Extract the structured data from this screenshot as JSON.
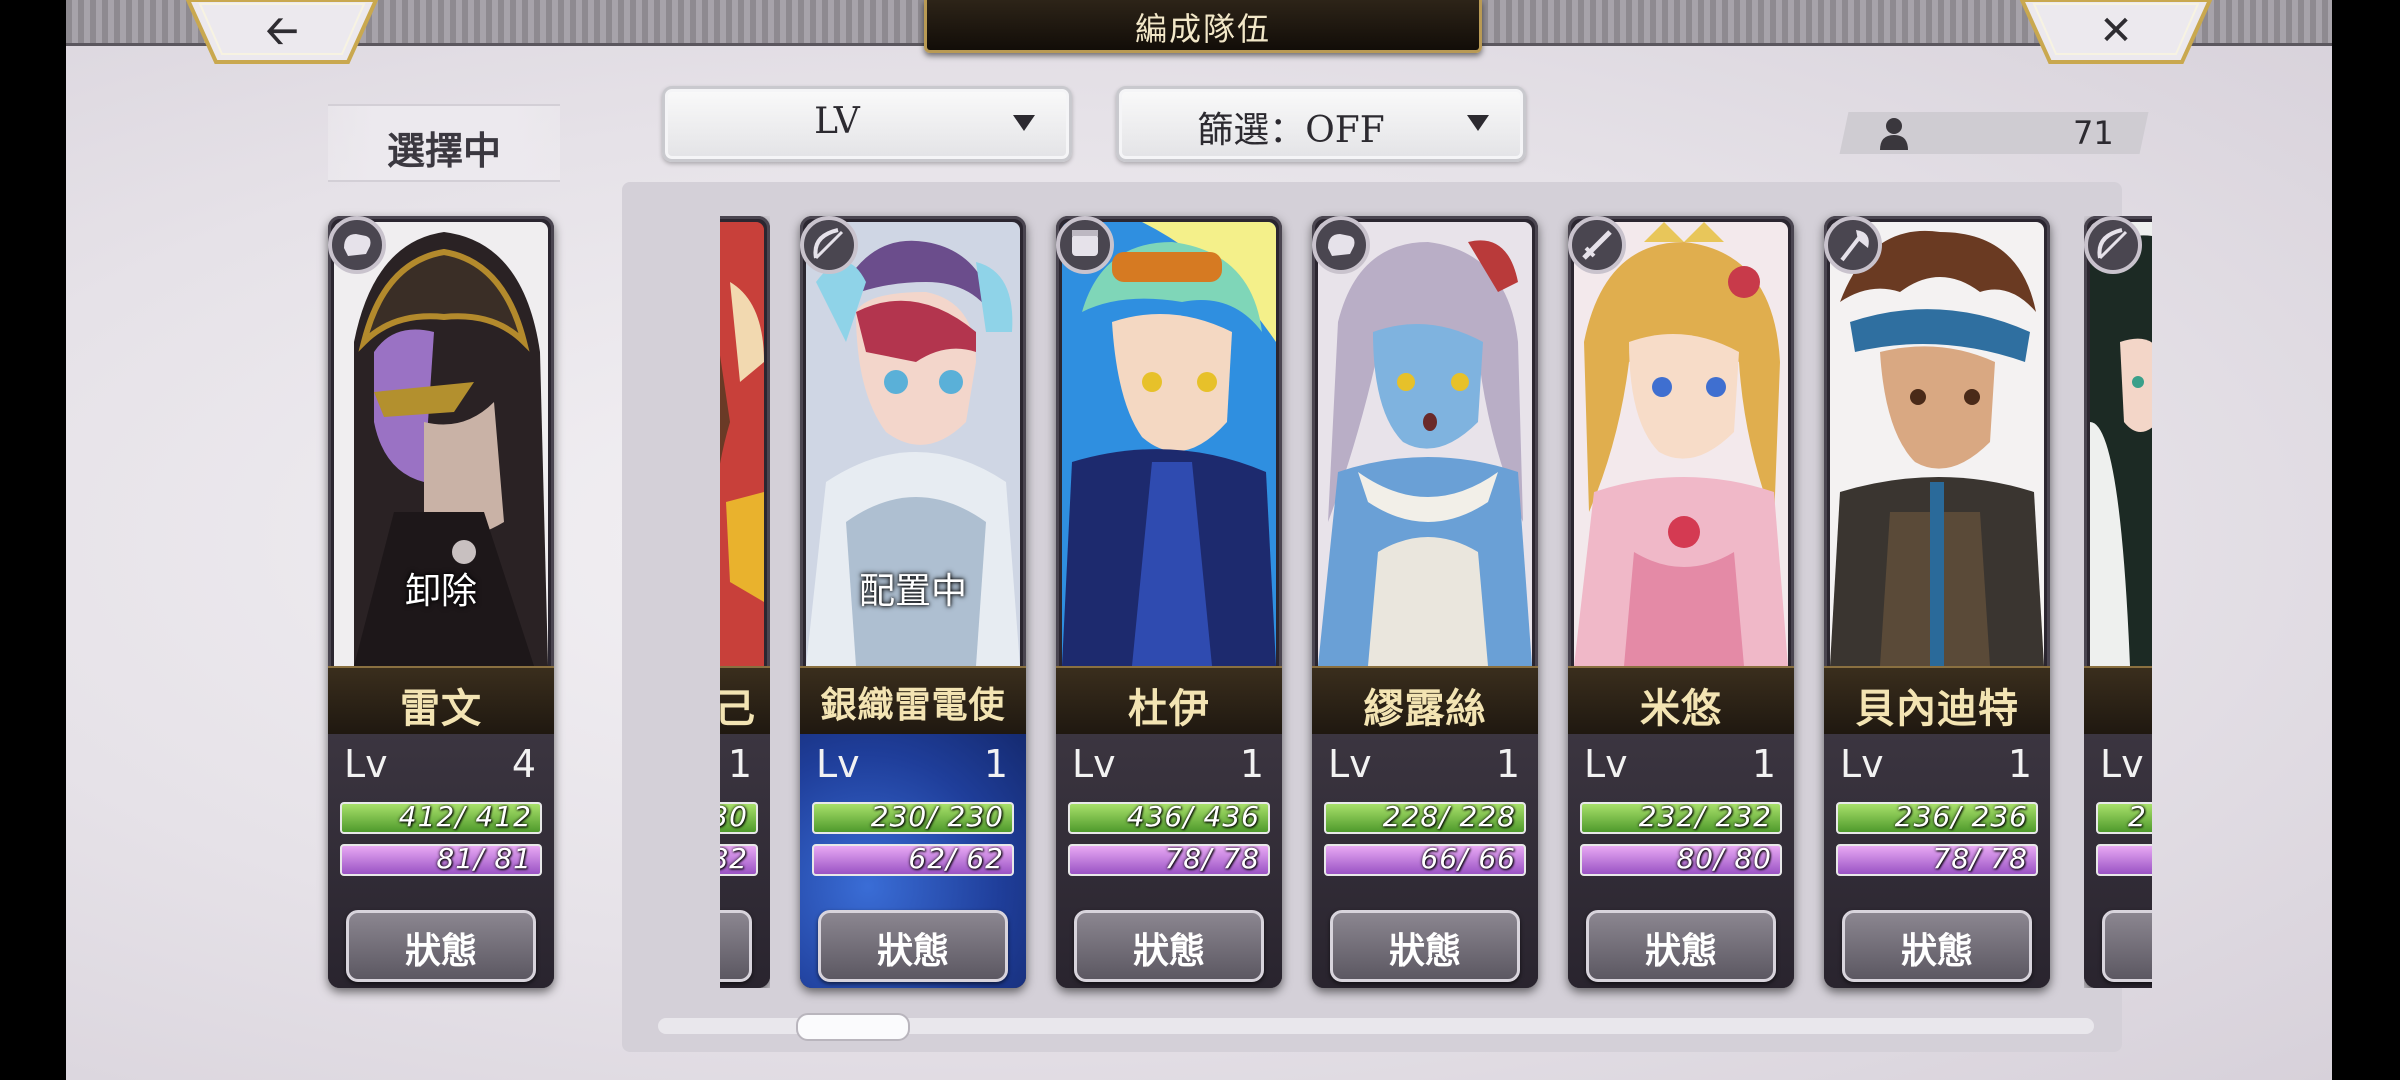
{
  "header": {
    "title": "編成隊伍",
    "back_icon": "back-arrow-icon",
    "close_icon": "close-icon"
  },
  "selected": {
    "label": "選擇中",
    "card": {
      "name": "雷文",
      "lv_label": "Lv",
      "lv": "4",
      "hp": "412/ 412",
      "mp": "81/ 81",
      "overlay": "卸除",
      "status": "狀態",
      "badge": "fist-icon"
    }
  },
  "sort_dropdown": {
    "value": "LV"
  },
  "filter_dropdown": {
    "value": "篩選：OFF"
  },
  "unit_count": {
    "icon": "person-icon",
    "value": "71"
  },
  "partial_left": {
    "name": "己",
    "lv": "1",
    "hp": "30",
    "mp": "82"
  },
  "cards": [
    {
      "name": "銀織雷電使",
      "lv_label": "Lv",
      "lv": "1",
      "hp": "230/ 230",
      "mp": "62/ 62",
      "overlay": "配置中",
      "status": "狀態",
      "badge": "bow-icon"
    },
    {
      "name": "杜伊",
      "lv_label": "Lv",
      "lv": "1",
      "hp": "436/ 436",
      "mp": "78/ 78",
      "overlay": "",
      "status": "狀態",
      "badge": "gauntlet-icon"
    },
    {
      "name": "繆露絲",
      "lv_label": "Lv",
      "lv": "1",
      "hp": "228/ 228",
      "mp": "66/ 66",
      "overlay": "",
      "status": "狀態",
      "badge": "fist-icon"
    },
    {
      "name": "米悠",
      "lv_label": "Lv",
      "lv": "1",
      "hp": "232/ 232",
      "mp": "80/ 80",
      "overlay": "",
      "status": "狀態",
      "badge": "sword-icon"
    },
    {
      "name": "貝內迪特",
      "lv_label": "Lv",
      "lv": "1",
      "hp": "236/ 236",
      "mp": "78/ 78",
      "overlay": "",
      "status": "狀態",
      "badge": "axe-icon"
    }
  ],
  "partial_right": {
    "lv_label": "Lv",
    "hp": "2"
  },
  "colors": {
    "name_gold": "#f3e4b3",
    "hp_green": "#6fbf3a",
    "mp_purple": "#c07be0",
    "frame_gold": "#b99a54"
  }
}
